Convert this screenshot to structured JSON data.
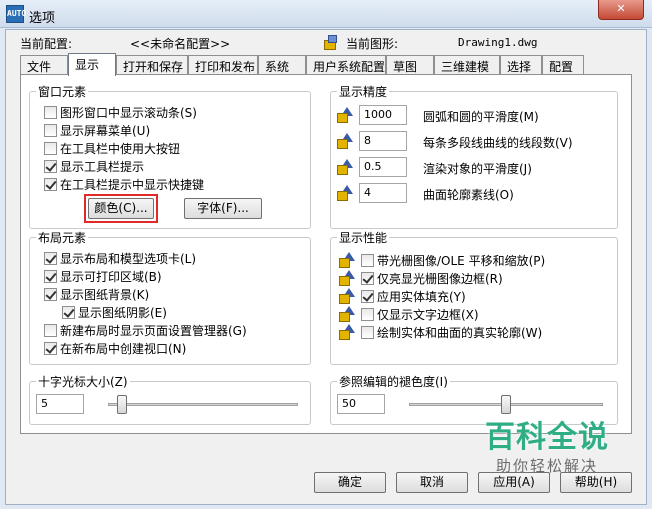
{
  "window": {
    "title": "选项",
    "app_icon_text": "AUTO",
    "close_label": "✕"
  },
  "header": {
    "current_profile_label": "当前配置:",
    "current_profile_value": "<<未命名配置>>",
    "current_drawing_label": "当前图形:",
    "current_drawing_value": "Drawing1.dwg"
  },
  "tabs": [
    "文件",
    "显示",
    "打开和保存",
    "打印和发布",
    "系统",
    "用户系统配置",
    "草图",
    "三维建模",
    "选择",
    "配置"
  ],
  "active_tab": "显示",
  "window_elements": {
    "title": "窗口元素",
    "items": [
      {
        "label": "图形窗口中显示滚动条(S)",
        "checked": false
      },
      {
        "label": "显示屏幕菜单(U)",
        "checked": false
      },
      {
        "label": "在工具栏中使用大按钮",
        "checked": false
      },
      {
        "label": "显示工具栏提示",
        "checked": true
      },
      {
        "label": "在工具栏提示中显示快捷键",
        "checked": true
      }
    ],
    "colors_button": "颜色(C)...",
    "fonts_button": "字体(F)..."
  },
  "display_resolution": {
    "title": "显示精度",
    "items": [
      {
        "value": "1000",
        "label": "圆弧和圆的平滑度(M)",
        "icon": "arc-smoothness-icon"
      },
      {
        "value": "8",
        "label": "每条多段线曲线的线段数(V)",
        "icon": "polyline-segments-icon"
      },
      {
        "value": "0.5",
        "label": "渲染对象的平滑度(J)",
        "icon": "render-smoothness-icon"
      },
      {
        "value": "4",
        "label": "曲面轮廓素线(O)",
        "icon": "contour-lines-icon"
      }
    ]
  },
  "layout_elements": {
    "title": "布局元素",
    "items": [
      {
        "label": "显示布局和模型选项卡(L)",
        "checked": true,
        "indent": false
      },
      {
        "label": "显示可打印区域(B)",
        "checked": true,
        "indent": false
      },
      {
        "label": "显示图纸背景(K)",
        "checked": true,
        "indent": false
      },
      {
        "label": "显示图纸阴影(E)",
        "checked": true,
        "indent": true
      },
      {
        "label": "新建布局时显示页面设置管理器(G)",
        "checked": false,
        "indent": false
      },
      {
        "label": "在新布局中创建视口(N)",
        "checked": true,
        "indent": false
      }
    ]
  },
  "display_performance": {
    "title": "显示性能",
    "items": [
      {
        "label": "带光栅图像/OLE 平移和缩放(P)",
        "checked": false
      },
      {
        "label": "仅亮显光栅图像边框(R)",
        "checked": true
      },
      {
        "label": "应用实体填充(Y)",
        "checked": true
      },
      {
        "label": "仅显示文字边框(X)",
        "checked": false
      },
      {
        "label": "绘制实体和曲面的真实轮廓(W)",
        "checked": false
      }
    ]
  },
  "crosshair": {
    "title": "十字光标大小(Z)",
    "value": "5",
    "fraction": 0.05
  },
  "xref_fade": {
    "title": "参照编辑的褪色度(I)",
    "value": "50",
    "fraction": 0.5
  },
  "footer": {
    "ok": "确定",
    "cancel": "取消",
    "apply": "应用(A)",
    "help": "帮助(H)"
  },
  "watermark": {
    "main": "百科全说",
    "sub": "助你轻松解决"
  },
  "colors": {
    "accent": "#2fae86",
    "highlight_border": "#e02a2a",
    "titlebar": "#dfe8f3"
  }
}
